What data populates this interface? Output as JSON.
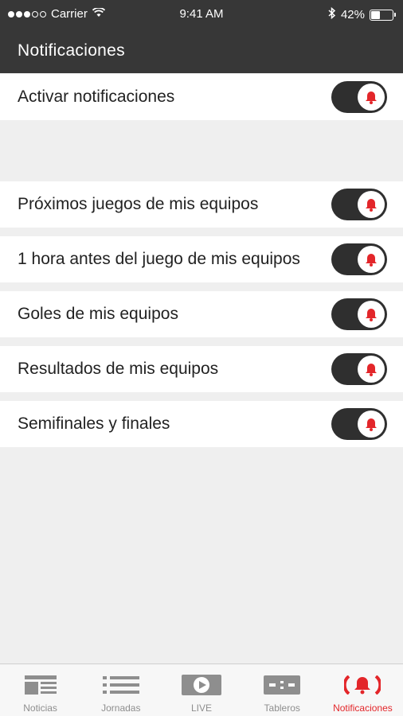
{
  "status_bar": {
    "carrier": "Carrier",
    "time": "9:41 AM",
    "battery": "42%"
  },
  "header": {
    "title": "Notificaciones"
  },
  "settings": [
    {
      "label": "Activar notificaciones",
      "enabled": true
    },
    {
      "label": "Próximos juegos de mis equipos",
      "enabled": true
    },
    {
      "label": "1 hora antes del juego de mis equipos",
      "enabled": true
    },
    {
      "label": "Goles de mis equipos",
      "enabled": true
    },
    {
      "label": "Resultados de mis equipos",
      "enabled": true
    },
    {
      "label": "Semifinales y finales",
      "enabled": true
    }
  ],
  "tabs": [
    {
      "label": "Noticias",
      "icon": "news-icon",
      "active": false
    },
    {
      "label": "Jornadas",
      "icon": "list-icon",
      "active": false
    },
    {
      "label": "LIVE",
      "icon": "play-icon",
      "active": false
    },
    {
      "label": "Tableros",
      "icon": "scoreboard-icon",
      "active": false
    },
    {
      "label": "Notificaciones",
      "icon": "bell-icon",
      "active": true
    }
  ],
  "colors": {
    "header_bg": "#373737",
    "toggle_on": "#2f2f2f",
    "accent": "#e3262a",
    "background": "#efefef"
  }
}
